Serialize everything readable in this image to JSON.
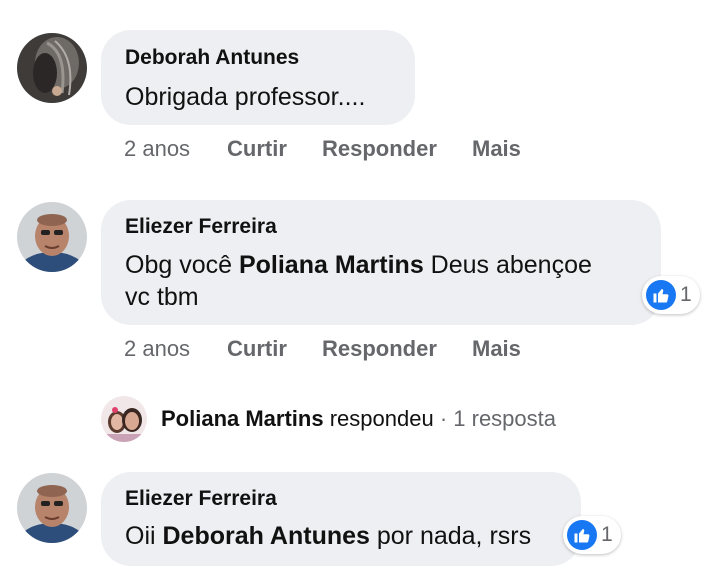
{
  "comments": [
    {
      "author": "Deborah Antunes",
      "text_parts": [
        "Obrigada professor...."
      ],
      "time": "2 anos",
      "like_label": "Curtir",
      "reply_label": "Responder",
      "more_label": "Mais"
    },
    {
      "author": "Eliezer Ferreira",
      "text_parts": [
        "Obg você ",
        "Poliana Martins",
        " Deus abençoe",
        "vc tbm"
      ],
      "time": "2 anos",
      "like_label": "Curtir",
      "reply_label": "Responder",
      "more_label": "Mais",
      "reaction_count": "1"
    },
    {
      "author": "Eliezer Ferreira",
      "text_parts": [
        "Oii ",
        "Deborah Antunes",
        " por nada, rsrs"
      ],
      "reaction_count": "1"
    }
  ],
  "reply_summary": {
    "name": "Poliana Martins",
    "verb": "respondeu",
    "count": "· 1 resposta"
  },
  "colors": {
    "bubble": "#eeeff2",
    "like_blue": "#1877f2",
    "meta_gray": "#65676b"
  }
}
